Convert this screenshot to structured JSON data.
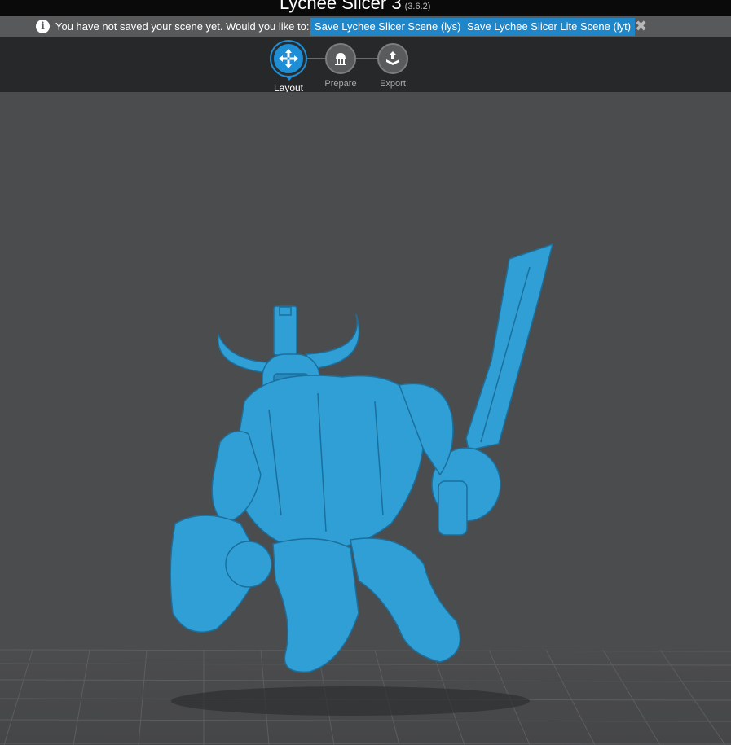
{
  "app": {
    "title": "Lychee Slicer 3",
    "version": "(3.6.2)"
  },
  "notice": {
    "icon": "info-icon",
    "message": "You have not saved your scene yet. Would you like to:",
    "save_lys_label": "Save Lychee Slicer Scene (lys)",
    "save_lyt_label": "Save Lychee Slicer Lite Scene (lyt)",
    "close_glyph": "✖"
  },
  "steps": [
    {
      "label": "Layout",
      "icon": "move-arrows-icon",
      "active": true
    },
    {
      "label": "Prepare",
      "icon": "supports-icon",
      "active": false
    },
    {
      "label": "Export",
      "icon": "export-icon",
      "active": false
    }
  ],
  "colors": {
    "accent": "#1e8fd6",
    "model": "#2f9fd6",
    "viewport_bg": "#4b4c4e",
    "toolbar_bg": "#27282a"
  }
}
